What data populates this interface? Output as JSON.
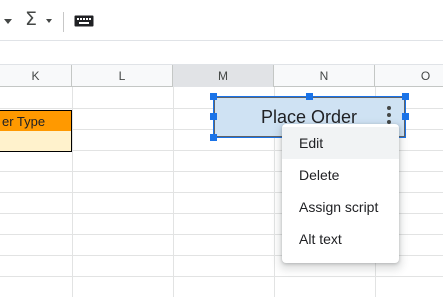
{
  "toolbar": {
    "items": [
      {
        "icon": "caret-down-icon"
      },
      {
        "icon": "sigma-icon",
        "label": "Σ"
      },
      {
        "icon": "caret-down-icon"
      },
      {
        "icon": "keyboard-icon"
      }
    ]
  },
  "columns": [
    "K",
    "L",
    "M",
    "N",
    "O"
  ],
  "selected_column": "M",
  "cells": {
    "order_type_header": "er Type"
  },
  "drawing": {
    "label": "Place Order",
    "fill_color": "#cfe2f3",
    "selection_color": "#1a73e8"
  },
  "context_menu": {
    "items": [
      "Edit",
      "Delete",
      "Assign script",
      "Alt text"
    ]
  },
  "colors": {
    "header_orange": "#ff9900",
    "cell_light_yellow": "#fff2cc"
  }
}
